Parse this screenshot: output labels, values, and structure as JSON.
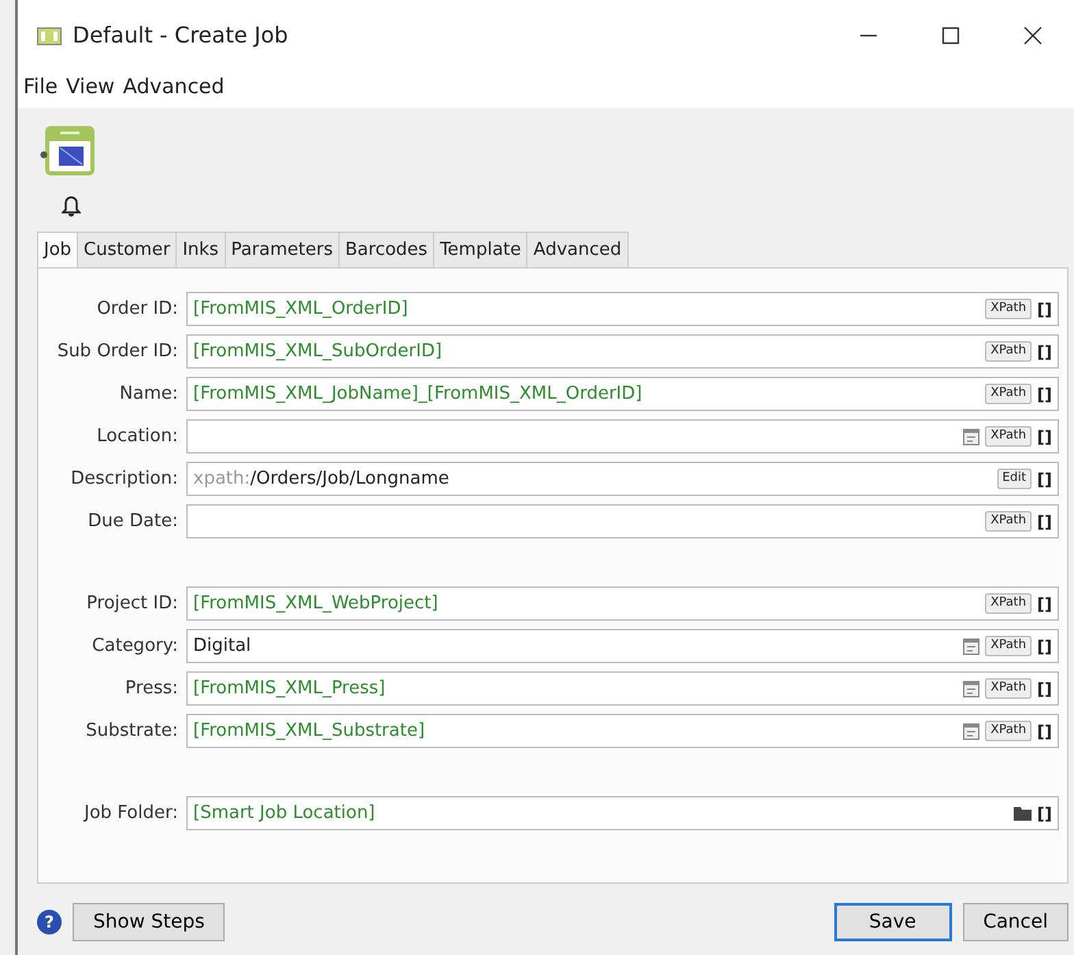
{
  "window": {
    "title": "Default - Create Job"
  },
  "menu": [
    "File",
    "View",
    "Advanced"
  ],
  "tabs": [
    {
      "label": "Job",
      "selected": true
    },
    {
      "label": "Customer",
      "selected": false
    },
    {
      "label": "Inks",
      "selected": false
    },
    {
      "label": "Parameters",
      "selected": false
    },
    {
      "label": "Barcodes",
      "selected": false
    },
    {
      "label": "Template",
      "selected": false
    },
    {
      "label": "Advanced",
      "selected": false
    }
  ],
  "field_groups": [
    [
      {
        "label": "Order ID:",
        "value": "[FromMIS_XML_OrderID]",
        "variable": true,
        "tools": [
          {
            "kind": "button",
            "text": "XPath"
          },
          {
            "kind": "text",
            "text": "[]"
          }
        ]
      },
      {
        "label": "Sub Order ID:",
        "value": "[FromMIS_XML_SubOrderID]",
        "variable": true,
        "tools": [
          {
            "kind": "button",
            "text": "XPath"
          },
          {
            "kind": "text",
            "text": "[]"
          }
        ]
      },
      {
        "label": "Name:",
        "value": "[FromMIS_XML_JobName]_[FromMIS_XML_OrderID]",
        "variable": true,
        "tools": [
          {
            "kind": "button",
            "text": "XPath"
          },
          {
            "kind": "text",
            "text": "[]"
          }
        ]
      },
      {
        "label": "Location:",
        "tools": [
          {
            "kind": "list"
          },
          {
            "kind": "button",
            "text": "XPath"
          },
          {
            "kind": "text",
            "text": "[]"
          }
        ]
      },
      {
        "label": "Description:",
        "prefix": "xpath:",
        "value": "/Orders/Job/Longname",
        "variable": false,
        "tools": [
          {
            "kind": "button",
            "text": "Edit"
          },
          {
            "kind": "text",
            "text": "[]"
          }
        ]
      },
      {
        "label": "Due Date:",
        "tools": [
          {
            "kind": "button",
            "text": "XPath"
          },
          {
            "kind": "text",
            "text": "[]"
          }
        ]
      }
    ],
    [
      {
        "label": "Project ID:",
        "value": "[FromMIS_XML_WebProject]",
        "variable": true,
        "tools": [
          {
            "kind": "button",
            "text": "XPath"
          },
          {
            "kind": "text",
            "text": "[]"
          }
        ]
      },
      {
        "label": "Category:",
        "value": "Digital",
        "variable": false,
        "tools": [
          {
            "kind": "list"
          },
          {
            "kind": "button",
            "text": "XPath"
          },
          {
            "kind": "text",
            "text": "[]"
          }
        ]
      },
      {
        "label": "Press:",
        "value": "[FromMIS_XML_Press]",
        "variable": true,
        "tools": [
          {
            "kind": "list"
          },
          {
            "kind": "button",
            "text": "XPath"
          },
          {
            "kind": "text",
            "text": "[]"
          }
        ]
      },
      {
        "label": "Substrate:",
        "value": "[FromMIS_XML_Substrate]",
        "variable": true,
        "tools": [
          {
            "kind": "list"
          },
          {
            "kind": "button",
            "text": "XPath"
          },
          {
            "kind": "text",
            "text": "[]"
          }
        ]
      }
    ],
    [
      {
        "label": "Job Folder:",
        "value": "[Smart Job Location]",
        "variable": true,
        "tools": [
          {
            "kind": "folder"
          },
          {
            "kind": "text",
            "text": "[]"
          }
        ]
      }
    ]
  ],
  "footer": {
    "help": "?",
    "left_button": "Show Steps",
    "buttons": [
      {
        "label": "Save",
        "default": true
      },
      {
        "label": "Cancel",
        "default": false
      }
    ]
  }
}
